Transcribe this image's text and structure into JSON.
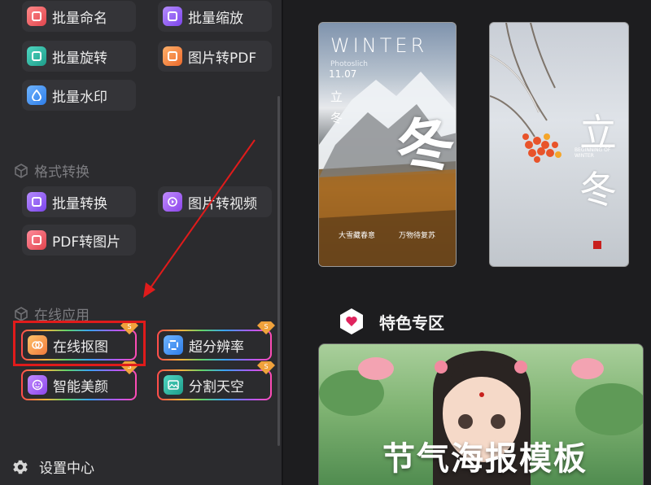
{
  "sidebar": {
    "top_tools": [
      {
        "label": "批量命名",
        "icon": "batch-rename-icon",
        "color": "#e85a5a"
      },
      {
        "label": "批量缩放",
        "icon": "batch-resize-icon",
        "color": "#8d5cf0"
      },
      {
        "label": "批量旋转",
        "icon": "batch-rotate-icon",
        "color": "#2bb3a0"
      },
      {
        "label": "图片转PDF",
        "icon": "image-to-pdf-icon",
        "color": "#f07a3c"
      },
      {
        "label": "批量水印",
        "icon": "batch-watermark-icon",
        "color": "#3a8ef0"
      }
    ],
    "format_section": {
      "title": "格式转换",
      "tools": [
        {
          "label": "批量转换",
          "icon": "batch-convert-icon",
          "color": "#8d5cf0"
        },
        {
          "label": "图片转视频",
          "icon": "image-to-video-icon",
          "color": "#a25cf0"
        },
        {
          "label": "PDF转图片",
          "icon": "pdf-to-image-icon",
          "color": "#e8505a"
        }
      ]
    },
    "online_section": {
      "title": "在线应用",
      "tools": [
        {
          "label": "在线抠图",
          "icon": "online-cutout-icon",
          "color": "#f08a3c"
        },
        {
          "label": "超分辨率",
          "icon": "super-resolution-icon",
          "color": "#3a8ef0"
        },
        {
          "label": "智能美颜",
          "icon": "smart-beauty-icon",
          "color": "#a25cf0"
        },
        {
          "label": "分割天空",
          "icon": "sky-segment-icon",
          "color": "#2bb3a0"
        }
      ],
      "premium_badge": "S"
    },
    "settings_label": "设置中心"
  },
  "main": {
    "poster_winter": {
      "title": "WINTER",
      "subtitle": "Photoslich",
      "date": "11.07",
      "vertical_text": "立冬",
      "big_char": "冬",
      "caption_left": "大雪藏春意",
      "caption_right": "万物待复苏"
    },
    "poster_lidong": {
      "title": "立冬",
      "subtitle": "BEGINNING OF WINTER"
    },
    "feature": {
      "title": "特色专区",
      "banner_title": "节气海报模板"
    }
  },
  "colors": {
    "highlight": "#e01b1b",
    "arrow": "#e01b1b",
    "feature_icon": "#e0245e"
  }
}
